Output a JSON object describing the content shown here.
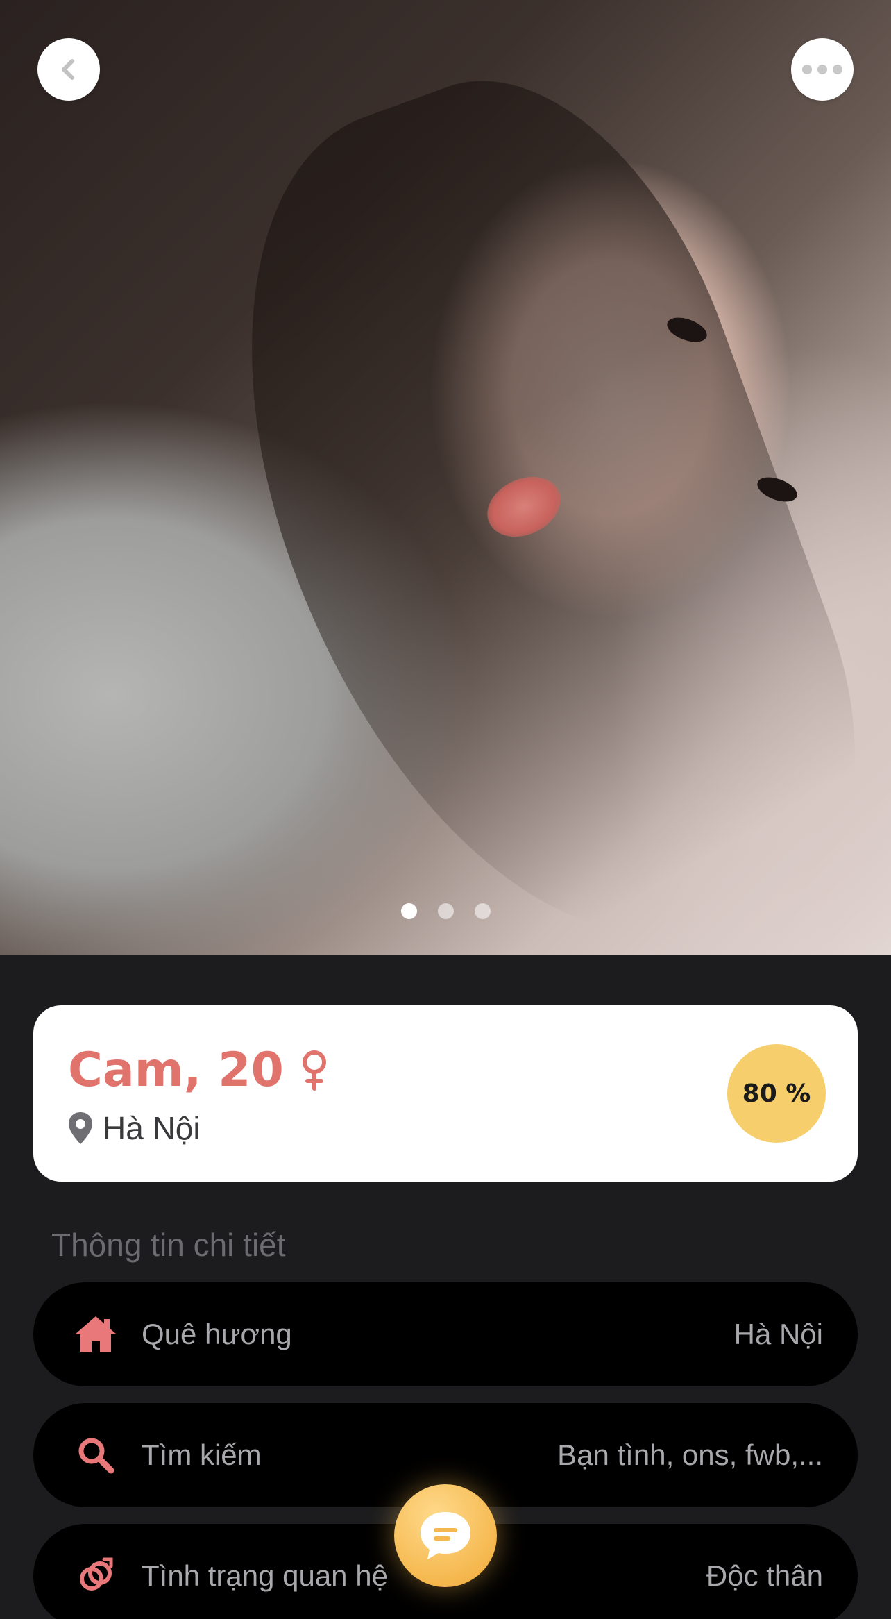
{
  "profile": {
    "name_age": "Cam, 20",
    "location": "Hà Nội",
    "match_percent": "80 %",
    "photo_count": 3,
    "photo_index": 1
  },
  "details": {
    "title": "Thông tin chi tiết",
    "rows": [
      {
        "icon": "home-icon",
        "label": "Quê hương",
        "value": "Hà Nội"
      },
      {
        "icon": "search-icon",
        "label": "Tìm kiếm",
        "value": "Bạn tình, ons, fwb,..."
      },
      {
        "icon": "relationship-icon",
        "label": "Tình trạng quan hệ",
        "value": "Độc thân"
      }
    ]
  },
  "colors": {
    "accent": "#e0746c",
    "badge": "#f6cf6c",
    "background": "#1c1c1e",
    "row_background": "#000000",
    "fab": "#f5b84f"
  }
}
